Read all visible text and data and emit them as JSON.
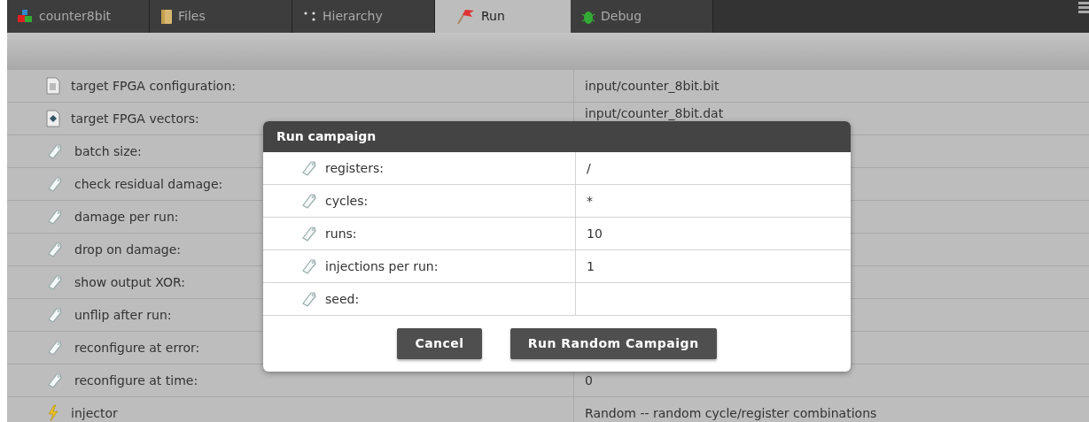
{
  "tabs": [
    {
      "label": "counter8bit",
      "selected": false
    },
    {
      "label": "Files",
      "selected": false
    },
    {
      "label": "Hierarchy",
      "selected": false
    },
    {
      "label": "Run",
      "selected": true
    },
    {
      "label": "Debug",
      "selected": false
    }
  ],
  "properties": [
    {
      "kind": "file",
      "label": "target FPGA configuration:",
      "value": "input/counter_8bit.bit"
    },
    {
      "kind": "vectors",
      "label": "target FPGA vectors:",
      "value": "input/counter_8bit.dat"
    },
    {
      "kind": "tag",
      "label": "batch size:"
    },
    {
      "kind": "tag",
      "label": "check residual damage:"
    },
    {
      "kind": "tag",
      "label": "damage per run:"
    },
    {
      "kind": "tag",
      "label": "drop on damage:"
    },
    {
      "kind": "tag",
      "label": "show output XOR:"
    },
    {
      "kind": "tag",
      "label": "unflip after run:"
    },
    {
      "kind": "tag",
      "label": "reconfigure at error:"
    },
    {
      "kind": "tag",
      "label": "reconfigure at time:",
      "value": "0"
    },
    {
      "kind": "bolt",
      "label": "injector",
      "value": "Random -- random cycle/register combinations"
    }
  ],
  "dialog": {
    "title": "Run campaign",
    "fields": [
      {
        "label": "registers:",
        "value": "/"
      },
      {
        "label": "cycles:",
        "value": "*"
      },
      {
        "label": "runs:",
        "value": "10"
      },
      {
        "label": "injections per run:",
        "value": "1"
      },
      {
        "label": "seed:"
      }
    ],
    "buttons": [
      "Cancel",
      "Run Random Campaign"
    ]
  }
}
